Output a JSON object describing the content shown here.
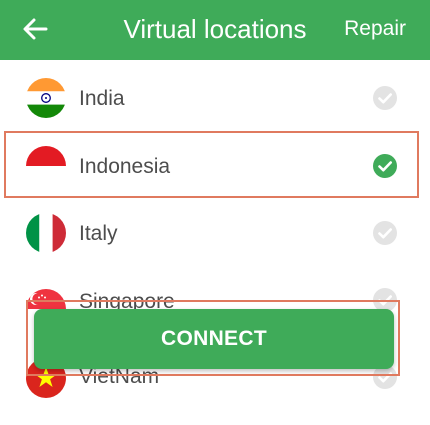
{
  "header": {
    "title": "Virtual locations",
    "repair_label": "Repair",
    "background_color": "#3fab59"
  },
  "locations": [
    {
      "name": "India",
      "flag": "india-flag-icon",
      "selected": false
    },
    {
      "name": "Indonesia",
      "flag": "indonesia-flag-icon",
      "selected": true
    },
    {
      "name": "Italy",
      "flag": "italy-flag-icon",
      "selected": false
    },
    {
      "name": "Singapore",
      "flag": "singapore-flag-icon",
      "selected": false
    },
    {
      "name": "VietNam",
      "flag": "vietnam-flag-icon",
      "selected": false
    }
  ],
  "connect_button": {
    "label": "CONNECT",
    "color": "#3fab59"
  },
  "colors": {
    "selected_check": "#3fab59",
    "unselected_check": "#e3e3e3",
    "highlight_border": "#e07a5f"
  }
}
